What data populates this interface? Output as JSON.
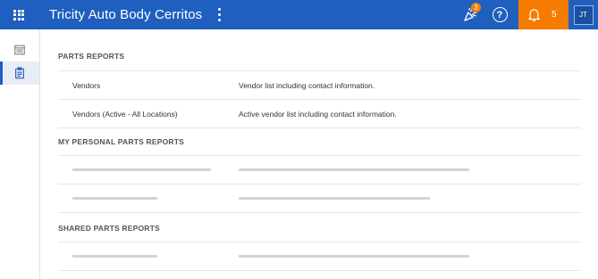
{
  "topbar": {
    "title": "Tricity Auto Body Cerritos",
    "celebrate_badge": "3",
    "help_glyph": "?",
    "notification_count": "5",
    "avatar_initials": "JT",
    "icons": [
      "apps-grid-icon",
      "more-vert-icon",
      "celebrate-icon",
      "help-icon",
      "bell-icon"
    ],
    "colors": {
      "bar": "#1f5fbf",
      "notification": "#f57c00"
    }
  },
  "sidebar": {
    "items": [
      {
        "icon": "report-list-icon",
        "active": false
      },
      {
        "icon": "clipboard-icon",
        "active": true
      }
    ]
  },
  "sections": {
    "parts_reports": {
      "title": "PARTS REPORTS",
      "rows": [
        {
          "name": "Vendors",
          "description": "Vendor list including contact information."
        },
        {
          "name": "Vendors (Active - All Locations)",
          "description": "Active vendor list including contact information."
        }
      ]
    },
    "my_personal": {
      "title": "MY PERSONAL PARTS REPORTS",
      "placeholder_rows": 2
    },
    "shared": {
      "title": "SHARED PARTS REPORTS",
      "placeholder_rows": 1
    }
  }
}
